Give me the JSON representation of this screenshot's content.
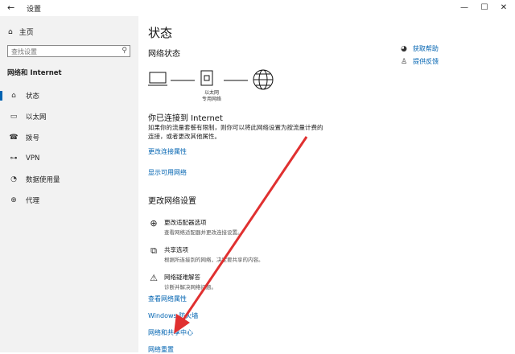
{
  "window": {
    "title": "设置",
    "back": "←",
    "minimize": "—",
    "maximize": "☐",
    "close": "✕"
  },
  "sidebar": {
    "home": "主页",
    "search_placeholder": "查找设置",
    "section_title": "网络和 Internet",
    "items": [
      {
        "label": "状态",
        "icon": "home-icon",
        "active": true
      },
      {
        "label": "以太网",
        "icon": "ethernet-icon"
      },
      {
        "label": "拨号",
        "icon": "dialup-icon"
      },
      {
        "label": "VPN",
        "icon": "vpn-icon"
      },
      {
        "label": "数据使用量",
        "icon": "data-usage-icon"
      },
      {
        "label": "代理",
        "icon": "globe-icon"
      }
    ]
  },
  "main": {
    "title": "状态",
    "network_status_heading": "网络状态",
    "network_caption_1": "以太网",
    "network_caption_2": "专用网络",
    "connected_title": "你已连接到 Internet",
    "connected_desc": "如果你的流量套餐有限制，则你可以将此网络设置为按流量计费的连接，或者更改其他属性。",
    "link_change_props": "更改连接属性",
    "link_show_networks": "显示可用网络",
    "change_settings_heading": "更改网络设置",
    "options": [
      {
        "title": "更改适配器选项",
        "desc": "查看网络适配器并更改连接设置。"
      },
      {
        "title": "共享选项",
        "desc": "根据所连接到的网络，决定要共享的内容。"
      },
      {
        "title": "网络疑难解答",
        "desc": "诊断并解决网络问题。"
      }
    ],
    "link_hardware": "查看网络属性",
    "link_firewall": "Windows 防火墙",
    "link_sharing_center": "网络和共享中心",
    "link_reset": "网络重置"
  },
  "help": {
    "get_help": "获取帮助",
    "feedback": "提供反馈"
  },
  "colors": {
    "accent": "#0063b1",
    "sidebar_bg": "#f2f2f2",
    "annotation_arrow": "#e03030"
  }
}
